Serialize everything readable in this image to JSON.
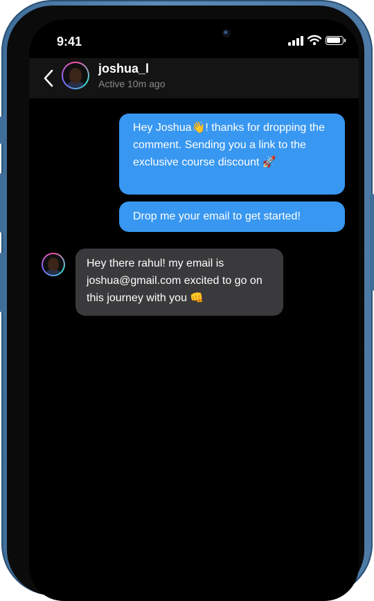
{
  "status_bar": {
    "time": "9:41",
    "battery_level": 0.9
  },
  "header": {
    "contact_name": "joshua_l",
    "contact_status": "Active 10m ago"
  },
  "messages": [
    {
      "direction": "outgoing",
      "text": "Hey Joshua👋! thanks for dropping the comment. Sending you a link to the exclusive course discount 🚀"
    },
    {
      "direction": "outgoing",
      "text": "Drop me your email to get started!"
    },
    {
      "direction": "incoming",
      "text": "Hey there rahul! my email is joshua@gmail.com excited to go on this journey with you 👊"
    }
  ],
  "colors": {
    "outgoing_bubble": "#3897f0",
    "incoming_bubble": "#3a3a3c",
    "frame": "#4d7aa6"
  },
  "icons": [
    "back-chevron-icon",
    "signal-icon",
    "wifi-icon",
    "battery-icon"
  ]
}
